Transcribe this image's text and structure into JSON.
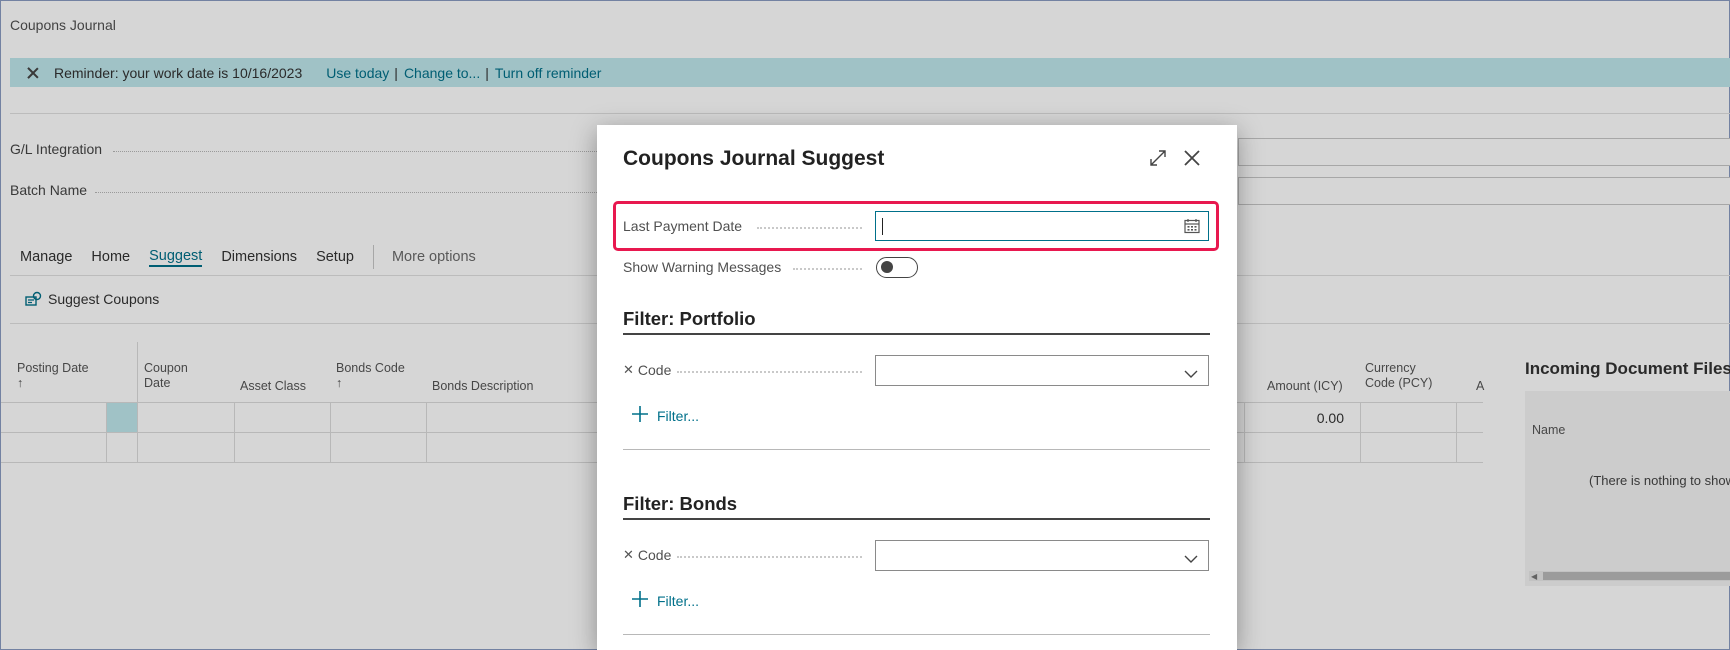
{
  "page": {
    "title": "Coupons Journal"
  },
  "reminder": {
    "text": "Reminder: your work date is 10/16/2023",
    "use_today": "Use today",
    "sep": "|",
    "change_to": "Change to...",
    "turn_off": "Turn off reminder"
  },
  "fields": {
    "gl_integration": "G/L Integration",
    "batch_name": "Batch Name"
  },
  "tabs": [
    "Manage",
    "Home",
    "Suggest",
    "Dimensions",
    "Setup"
  ],
  "more_options": "More options",
  "action": {
    "label": "Suggest Coupons"
  },
  "grid": {
    "columns": [
      {
        "line1": "Posting Date",
        "line2": "↑"
      },
      {
        "line1": "Coupon",
        "line2": "Date"
      },
      {
        "line1": "",
        "line2": "Asset Class"
      },
      {
        "line1": "Bonds Code",
        "line2": "↑"
      },
      {
        "line1": "",
        "line2": "Bonds Description"
      },
      {
        "line1": "",
        "line2": "Amount (ICY)"
      },
      {
        "line1": "Currency",
        "line2": "Code (PCY)"
      },
      {
        "line1": "",
        "line2": "A"
      }
    ],
    "amount_value": "0.00"
  },
  "incoming": {
    "title": "Incoming Document Files",
    "chevron": "⌄",
    "name_header": "Name",
    "empty": "(There is nothing to show"
  },
  "dialog": {
    "title": "Coupons Journal Suggest",
    "last_payment_date_label": "Last Payment Date",
    "last_payment_date_value": "",
    "show_warning_label": "Show Warning Messages",
    "show_warning_on": false,
    "section_portfolio": "Filter: Portfolio",
    "section_bonds": "Filter: Bonds",
    "code_label": "Code",
    "filter_link": "Filter..."
  },
  "colors": {
    "accent": "#00708a",
    "highlight": "#e8184f",
    "reminder_bg": "#bfe7ec"
  }
}
